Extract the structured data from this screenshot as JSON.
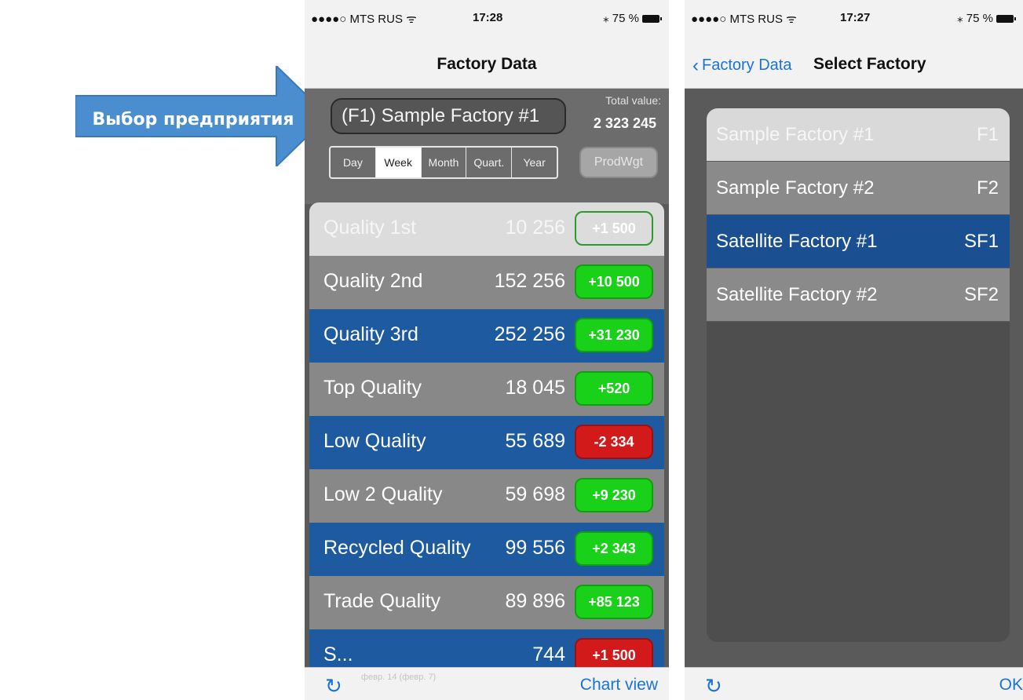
{
  "callout": {
    "text": "Выбор предприятия",
    "color": "#4a8ed0"
  },
  "left_phone": {
    "status": {
      "carrier": "●●●●○ MTS RUS ᯤ",
      "time": "17:28",
      "battery": "⁎ 75 %"
    },
    "nav_title": "Factory Data",
    "factory_selector": "(F1) Sample Factory #1",
    "total_label": "Total value:",
    "total_value": "2 323 245",
    "period_tabs": [
      "Day",
      "Week",
      "Month",
      "Quart.",
      "Year"
    ],
    "active_period": "Week",
    "prodwgt_label": "ProdWgt",
    "rows": [
      {
        "name": "Quality 1st",
        "value": "10 256",
        "delta": "+1 500",
        "style": "light",
        "delta_style": "outline"
      },
      {
        "name": "Quality 2nd",
        "value": "152 256",
        "delta": "+10 500",
        "style": "gray",
        "delta_style": "up"
      },
      {
        "name": "Quality 3rd",
        "value": "252 256",
        "delta": "+31 230",
        "style": "blue",
        "delta_style": "up"
      },
      {
        "name": "Top Quality",
        "value": "18 045",
        "delta": "+520",
        "style": "gray",
        "delta_style": "up"
      },
      {
        "name": "Low Quality",
        "value": "55 689",
        "delta": "-2 334",
        "style": "blue",
        "delta_style": "down"
      },
      {
        "name": "Low 2 Quality",
        "value": "59 698",
        "delta": "+9 230",
        "style": "gray",
        "delta_style": "up"
      },
      {
        "name": "Recycled Quality",
        "value": "99 556",
        "delta": "+2 343",
        "style": "blue",
        "delta_style": "up"
      },
      {
        "name": "Trade Quality",
        "value": "89 896",
        "delta": "+85 123",
        "style": "gray",
        "delta_style": "up"
      },
      {
        "name": "S...",
        "value": "744",
        "delta": "+1 500",
        "style": "blue",
        "delta_style": "down"
      }
    ],
    "toolbar": {
      "period_label": "февр. 14 (февр. 7)",
      "chart_view": "Chart view"
    }
  },
  "right_phone": {
    "status": {
      "carrier": "●●●●○ MTS RUS ᯤ",
      "time": "17:27",
      "battery": "⁎ 75 %"
    },
    "back_label": "Factory Data",
    "nav_title": "Select Factory",
    "factories": [
      {
        "name": "Sample Factory #1",
        "code": "F1",
        "style": "light"
      },
      {
        "name": "Sample Factory #2",
        "code": "F2",
        "style": "gray"
      },
      {
        "name": "Satellite Factory #1",
        "code": "SF1",
        "style": "blue"
      },
      {
        "name": "Satellite Factory #2",
        "code": "SF2",
        "style": "gray"
      }
    ],
    "ok_label": "OK"
  }
}
